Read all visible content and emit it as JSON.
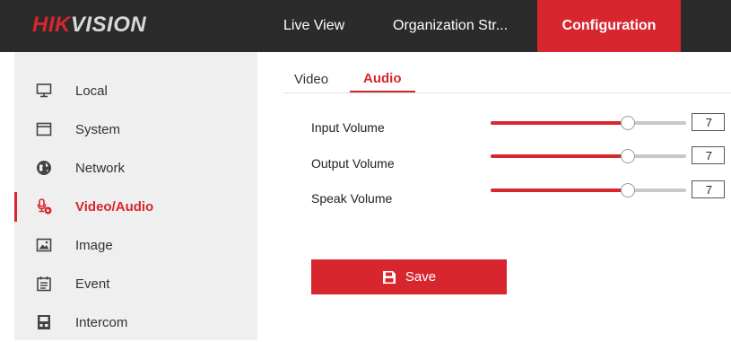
{
  "header": {
    "logo_primary": "HIK",
    "logo_secondary": "VISION",
    "nav": {
      "live_view": "Live View",
      "organization": "Organization Str...",
      "configuration": "Configuration"
    },
    "accent_color": "#d7262e"
  },
  "sidebar": {
    "items": [
      {
        "label": "Local",
        "icon": "monitor-icon"
      },
      {
        "label": "System",
        "icon": "system-window-icon"
      },
      {
        "label": "Network",
        "icon": "globe-icon"
      },
      {
        "label": "Video/Audio",
        "icon": "microphone-video-icon",
        "active": true
      },
      {
        "label": "Image",
        "icon": "image-icon"
      },
      {
        "label": "Event",
        "icon": "event-calendar-icon"
      },
      {
        "label": "Intercom",
        "icon": "intercom-icon"
      }
    ]
  },
  "tabs": {
    "video": "Video",
    "audio": "Audio",
    "active": "Audio"
  },
  "volumes": {
    "input": {
      "label": "Input Volume",
      "value": "7",
      "level": 0.7
    },
    "output": {
      "label": "Output Volume",
      "value": "7",
      "level": 0.7
    },
    "speak": {
      "label": "Speak Volume",
      "value": "7",
      "level": 0.7
    }
  },
  "save_button": {
    "label": "Save",
    "icon": "floppy-disk-icon"
  }
}
